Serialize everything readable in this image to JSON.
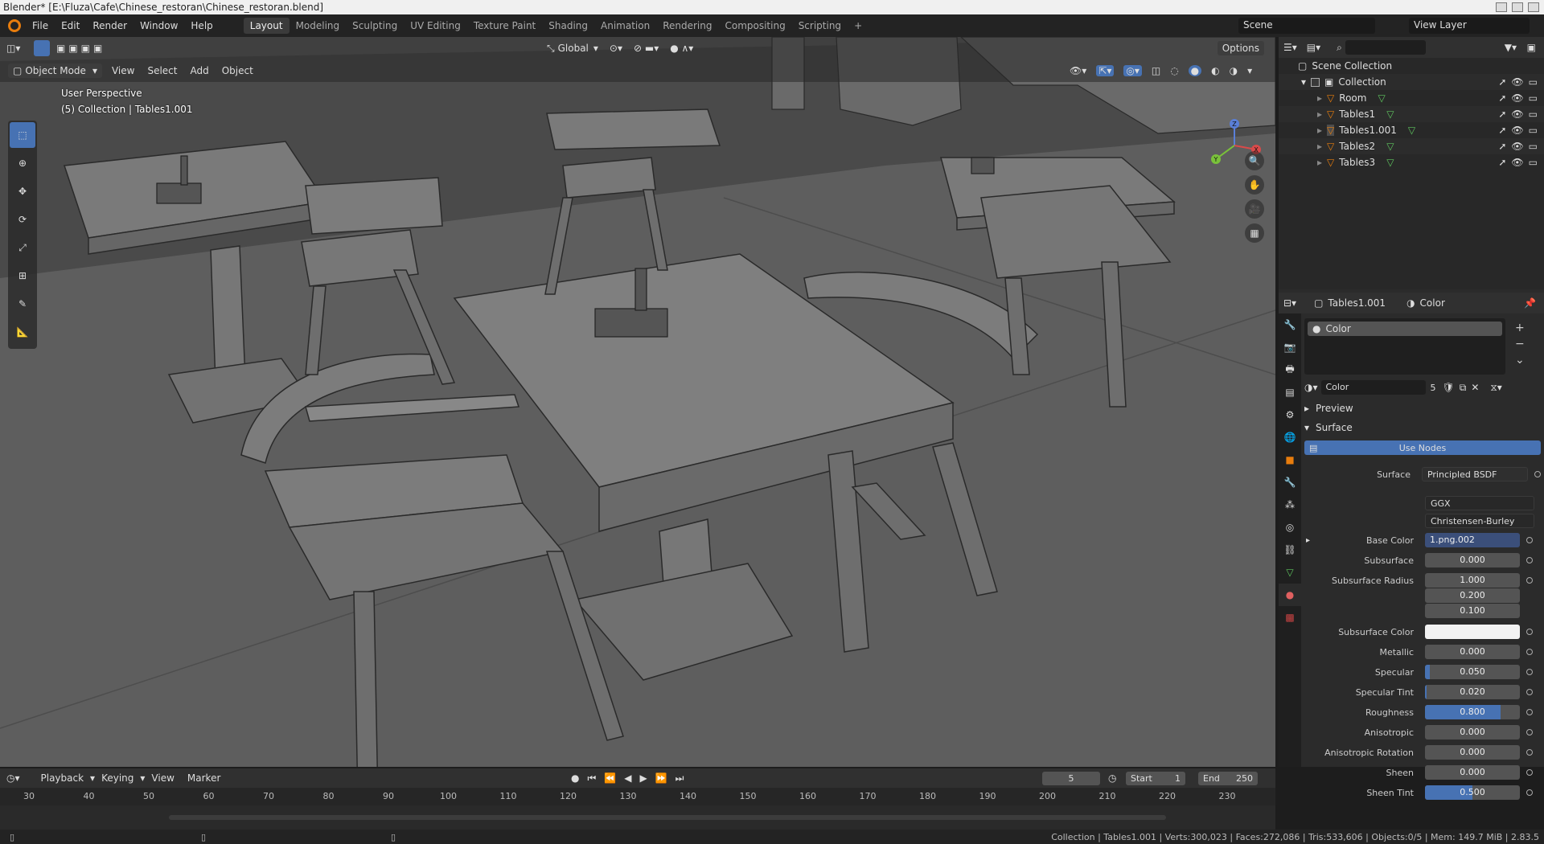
{
  "window": {
    "title": "Blender* [E:\\Fluza\\Cafe\\Chinese_restoran\\Chinese_restoran.blend]"
  },
  "menu": [
    "File",
    "Edit",
    "Render",
    "Window",
    "Help"
  ],
  "workspaces": [
    "Layout",
    "Modeling",
    "Sculpting",
    "UV Editing",
    "Texture Paint",
    "Shading",
    "Animation",
    "Rendering",
    "Compositing",
    "Scripting"
  ],
  "workspace_add": "+",
  "scene": {
    "name": "Scene",
    "view_layer": "View Layer"
  },
  "viewport": {
    "transform_orientation": "Global",
    "options_label": "Options",
    "mode": "Object Mode",
    "menus": [
      "View",
      "Select",
      "Add",
      "Object"
    ],
    "overlay_line1": "User Perspective",
    "overlay_line2": "(5) Collection | Tables1.001",
    "gizmo": {
      "x": "X",
      "y": "Y",
      "z": "Z"
    }
  },
  "outliner": {
    "root": "Scene Collection",
    "collection": "Collection",
    "items": [
      "Room",
      "Tables1",
      "Tables1.001",
      "Tables2",
      "Tables3"
    ],
    "selected": "Tables1.001"
  },
  "properties": {
    "object": "Tables1.001",
    "material_tab": "Color",
    "slot": "Color",
    "material_name": "Color",
    "users": "5",
    "sections": {
      "preview": "Preview",
      "surface": "Surface"
    },
    "use_nodes": "Use Nodes",
    "surface_label": "Surface",
    "surface_value": "Principled BSDF",
    "distribution": "GGX",
    "subsurface_method": "Christensen-Burley",
    "base_color_label": "Base Color",
    "base_color_value": "1.png.002",
    "fields": [
      {
        "label": "Subsurface",
        "value": "0.000",
        "level": 0
      },
      {
        "label": "Subsurface Radius",
        "value": "1.000",
        "level": 0
      },
      {
        "label": "",
        "value": "0.200",
        "level": 0
      },
      {
        "label": "",
        "value": "0.100",
        "level": 0
      },
      {
        "label": "Subsurface Color",
        "value": "",
        "level": 0
      },
      {
        "label": "Metallic",
        "value": "0.000",
        "level": 0
      },
      {
        "label": "Specular",
        "value": "0.050",
        "level": 0.05
      },
      {
        "label": "Specular Tint",
        "value": "0.020",
        "level": 0.02
      },
      {
        "label": "Roughness",
        "value": "0.800",
        "level": 0.8
      },
      {
        "label": "Anisotropic",
        "value": "0.000",
        "level": 0
      },
      {
        "label": "Anisotropic Rotation",
        "value": "0.000",
        "level": 0
      },
      {
        "label": "Sheen",
        "value": "0.000",
        "level": 0
      },
      {
        "label": "Sheen Tint",
        "value": "0.500",
        "level": 0.5
      }
    ]
  },
  "timeline": {
    "menus": [
      "Playback",
      "Keying",
      "View",
      "Marker"
    ],
    "current_frame": "5",
    "start_label": "Start",
    "start": "1",
    "end_label": "End",
    "end": "250",
    "ticks": [
      "30",
      "40",
      "50",
      "60",
      "70",
      "80",
      "90",
      "100",
      "110",
      "120",
      "130",
      "140",
      "150",
      "160",
      "170",
      "180",
      "190",
      "200",
      "210",
      "220",
      "230"
    ]
  },
  "status": "Collection | Tables1.001 | Verts:300,023 | Faces:272,086 | Tris:533,606 | Objects:0/5 | Mem: 149.7 MiB | 2.83.5",
  "colors": {
    "accent": "#4772b3",
    "object_orange": "#e87d0d",
    "mesh_green": "#5ec45e",
    "viewport_bg": "#5b5b5b"
  }
}
